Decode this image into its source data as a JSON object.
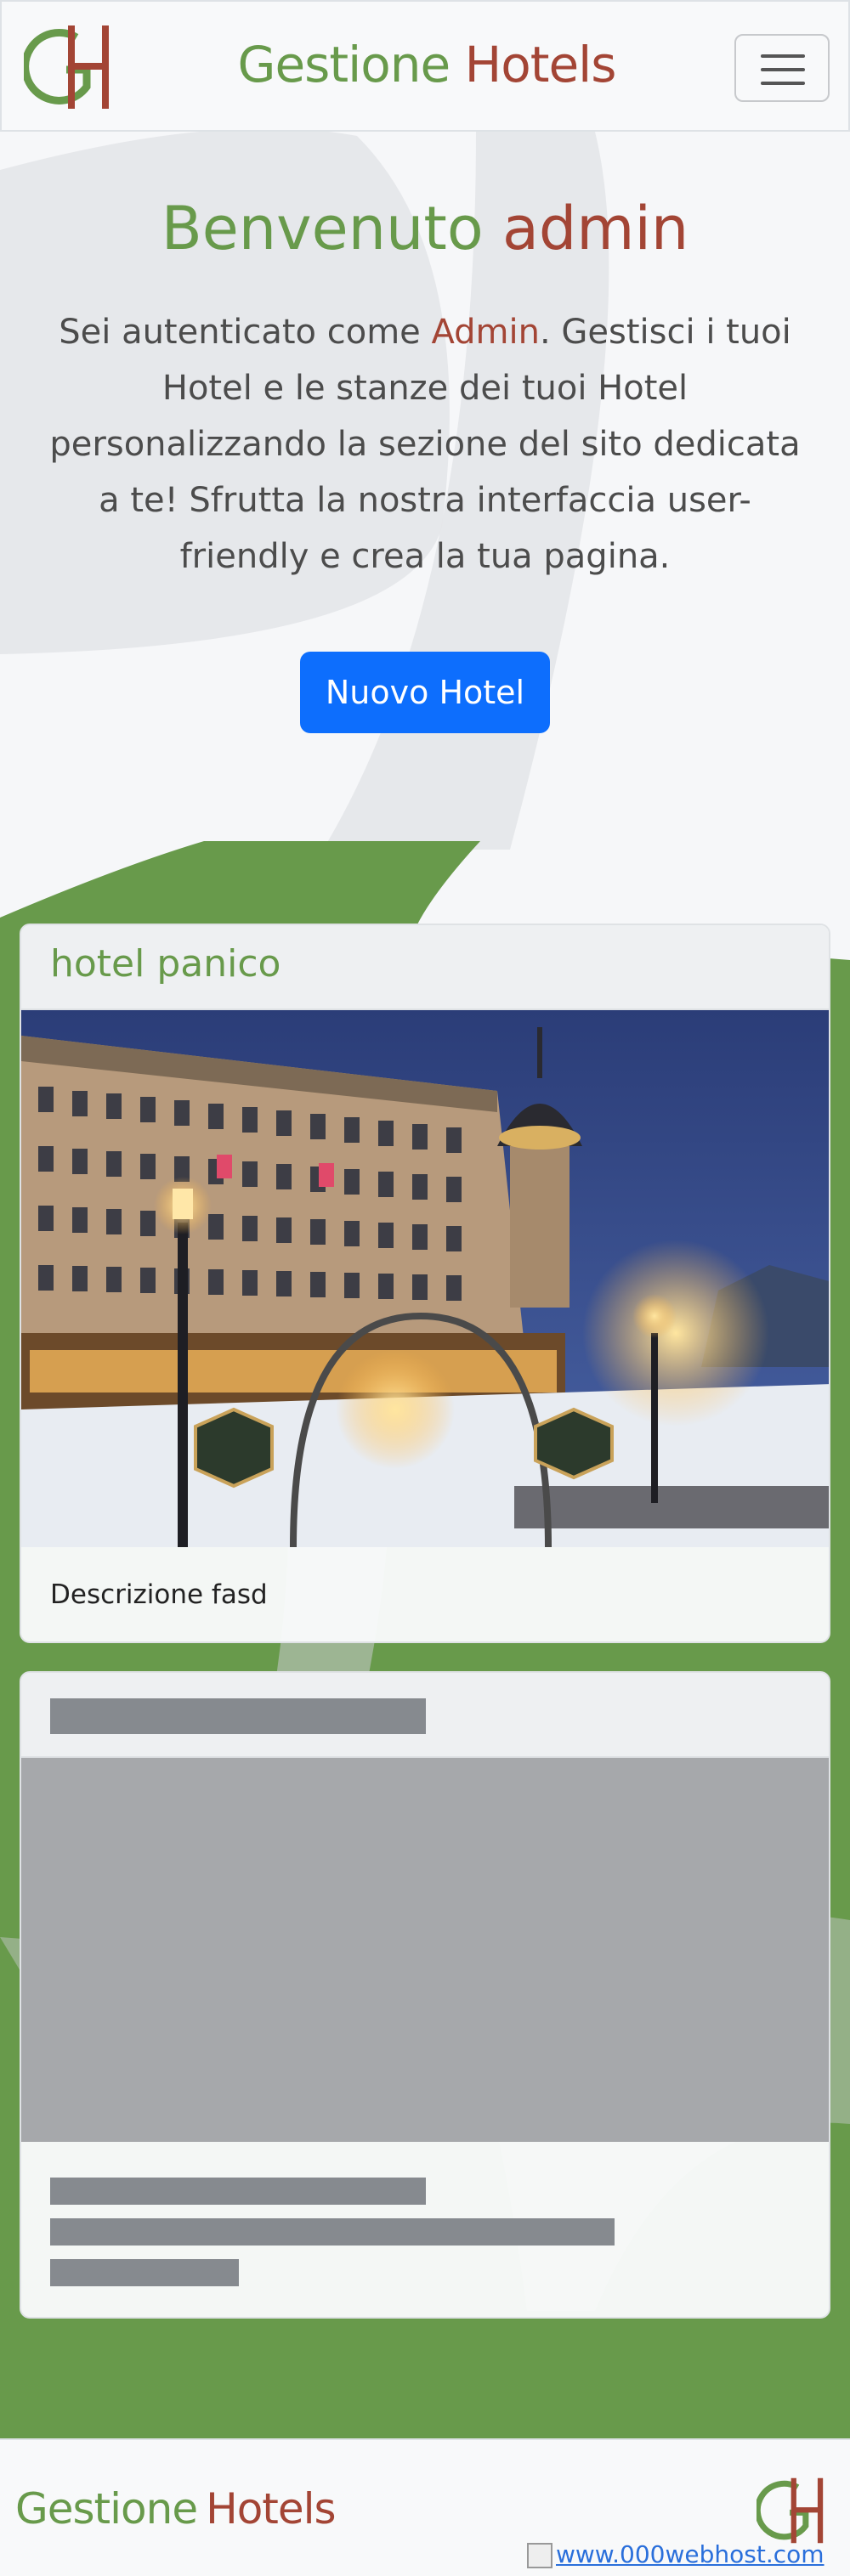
{
  "navbar": {
    "brand_part1": "Gestione",
    "brand_part2": "Hotels",
    "logo_letters": "GH",
    "toggler_icon": "hamburger-icon"
  },
  "hero": {
    "title_part1": "Benvenuto",
    "title_part2": "admin",
    "text_before": "Sei autenticato come ",
    "text_role": "Admin",
    "text_after": ". Gestisci i tuoi Hotel e le stanze dei tuoi Hotel personalizzando la sezione del sito dedicata a te! Sfrutta la nostra interfaccia user-friendly e crea la tua pagina.",
    "new_hotel_button": "Nuovo Hotel"
  },
  "hotels": [
    {
      "name": "hotel panico",
      "description": "Descrizione fasd"
    }
  ],
  "footer": {
    "brand_part1": "Gestione",
    "brand_part2": "Hotels",
    "host_link_text": "www.000webhost.com"
  },
  "colors": {
    "green": "#689a4b",
    "red": "#a34535",
    "primary_button": "#0d6efd",
    "background": "#f6f7f9"
  }
}
